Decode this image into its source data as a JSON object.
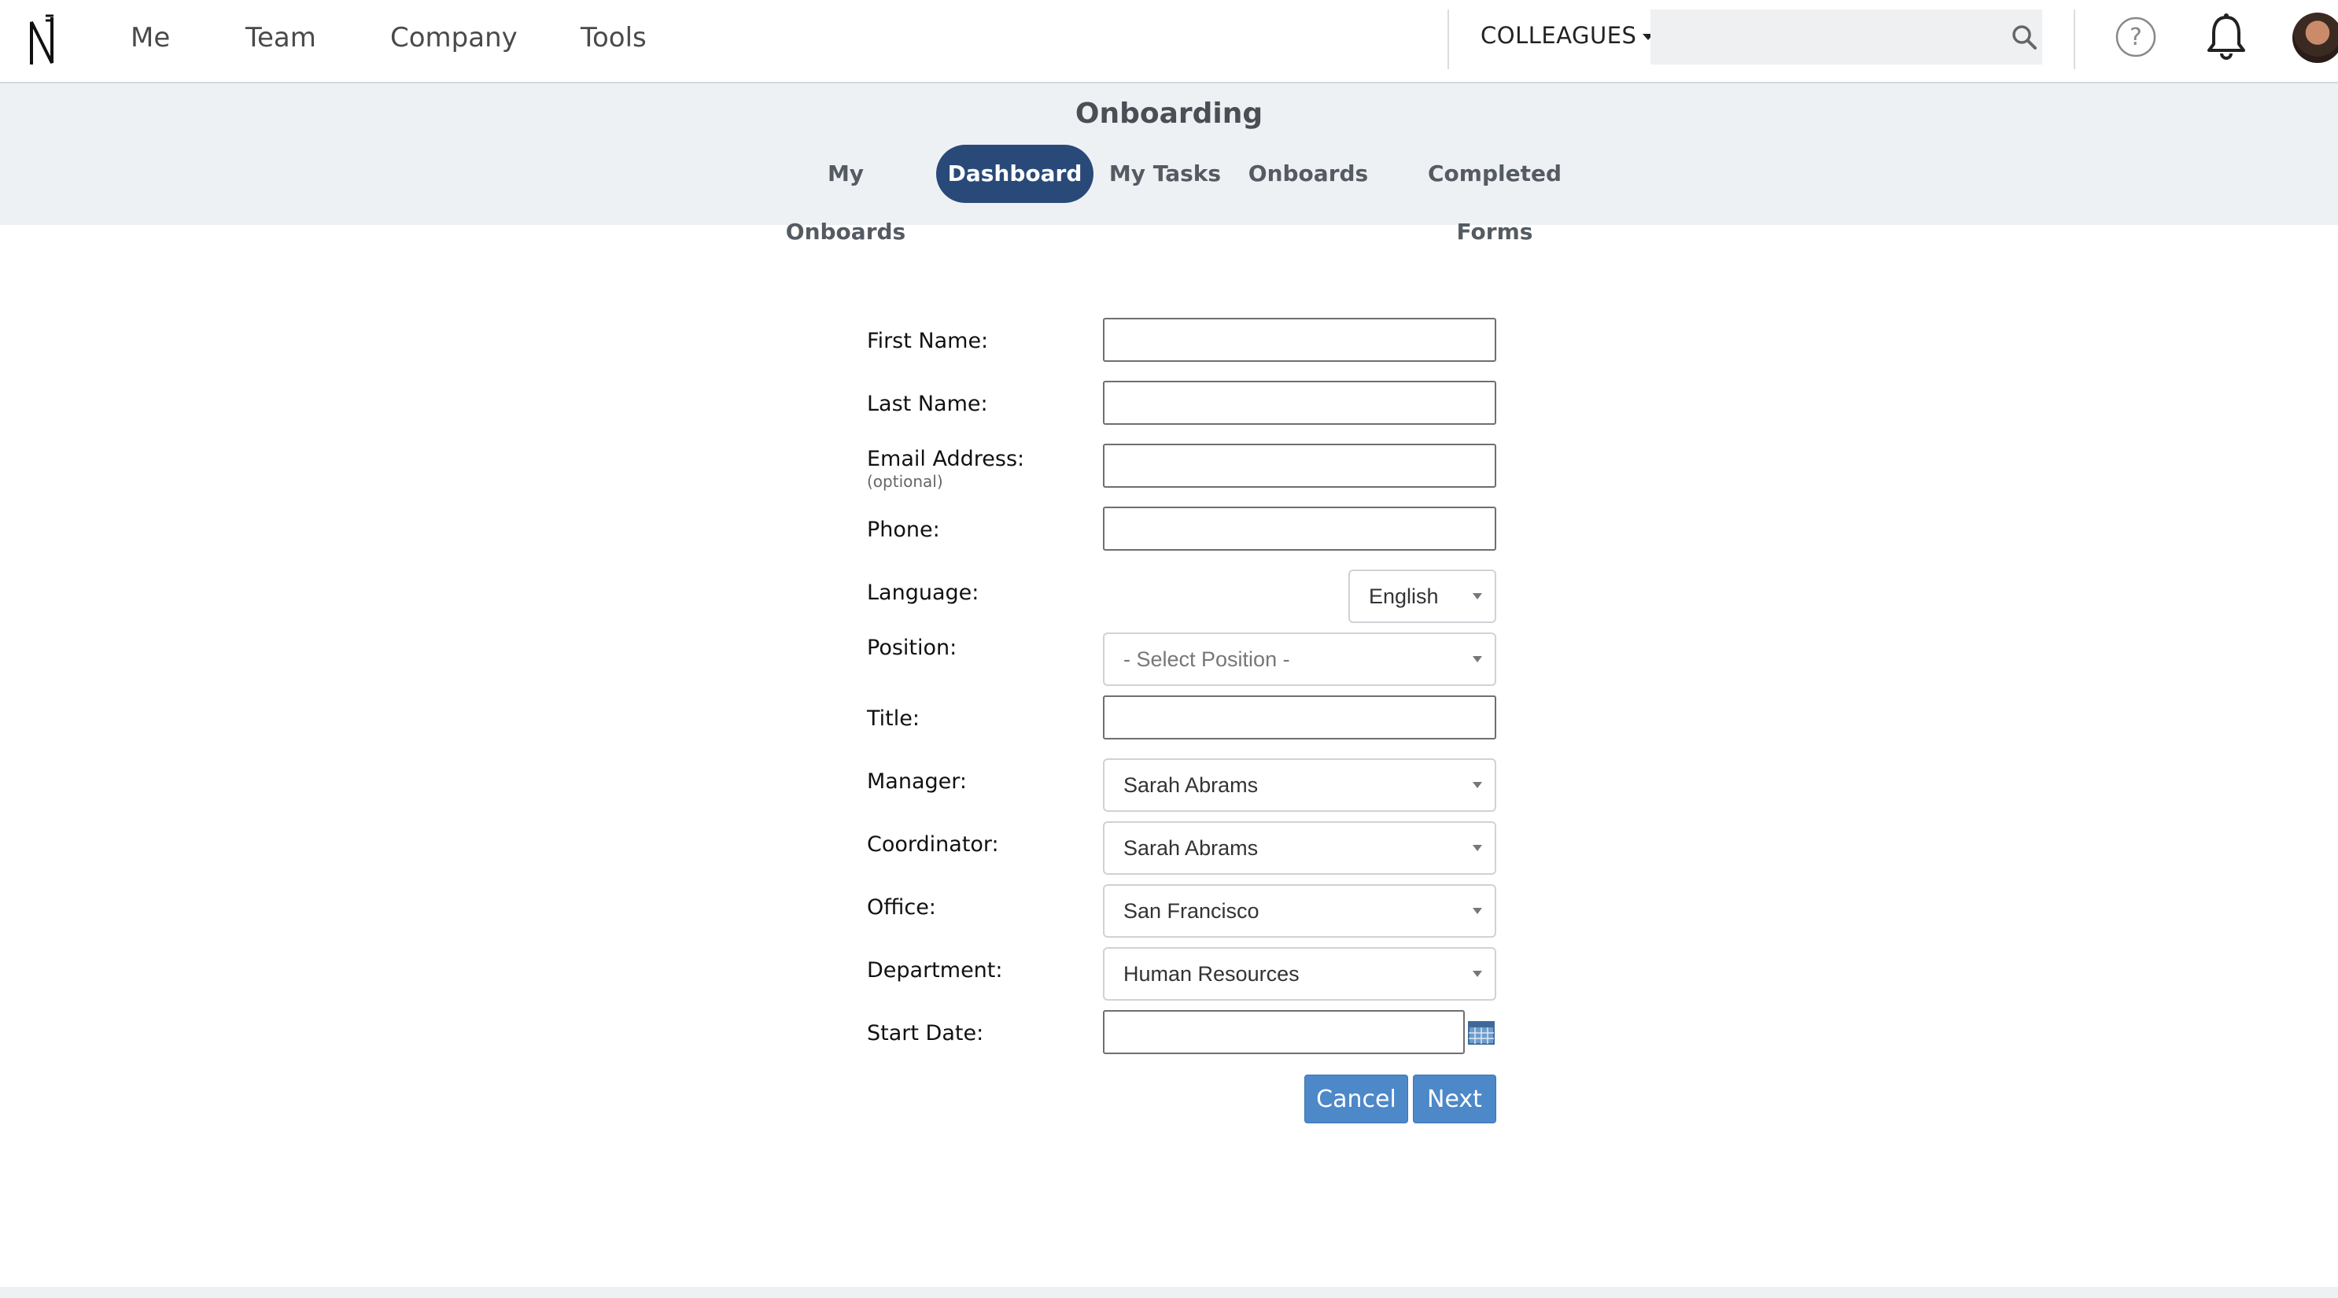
{
  "nav": {
    "items": [
      "Me",
      "Team",
      "Company",
      "Tools"
    ],
    "colleagues_label": "COLLEAGUES",
    "search_placeholder": ""
  },
  "header": {
    "title": "Onboarding",
    "tabs": [
      {
        "label": "My Onboards",
        "active": false
      },
      {
        "label": "Dashboard",
        "active": true
      },
      {
        "label": "My Tasks",
        "active": false
      },
      {
        "label": "Onboards",
        "active": false
      },
      {
        "label": "Completed Forms",
        "active": false
      }
    ]
  },
  "form": {
    "first_name": {
      "label": "First Name:",
      "value": ""
    },
    "last_name": {
      "label": "Last Name:",
      "value": ""
    },
    "email": {
      "label": "Email Address:",
      "sublabel": "(optional)",
      "value": ""
    },
    "phone": {
      "label": "Phone:",
      "value": ""
    },
    "language": {
      "label": "Language:",
      "value": "English"
    },
    "position": {
      "label": "Position:",
      "value": "- Select Position -"
    },
    "title": {
      "label": "Title:",
      "value": ""
    },
    "manager": {
      "label": "Manager:",
      "value": "Sarah Abrams"
    },
    "coordinator": {
      "label": "Coordinator:",
      "value": "Sarah Abrams"
    },
    "office": {
      "label": "Office:",
      "value": "San Francisco"
    },
    "department": {
      "label": "Department:",
      "value": "Human Resources"
    },
    "start_date": {
      "label": "Start Date:",
      "value": ""
    },
    "cancel_label": "Cancel",
    "next_label": "Next"
  },
  "colors": {
    "accent": "#294a79",
    "button": "#4d88c8",
    "subheader_bg": "#eef1f4"
  },
  "icons": [
    "logo-icon",
    "search-icon",
    "help-icon",
    "bell-icon",
    "avatar",
    "calendar-icon"
  ]
}
